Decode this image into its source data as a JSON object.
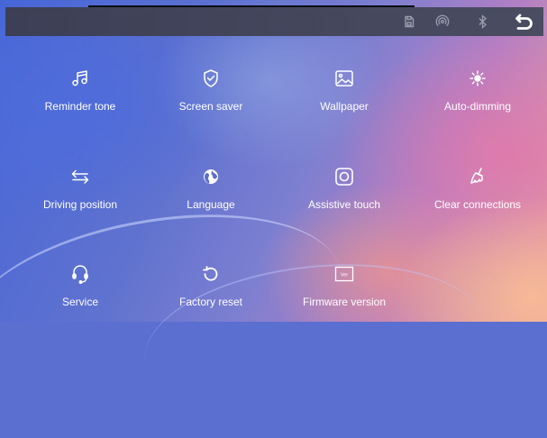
{
  "header": {
    "status_icons": [
      "sd-card-icon",
      "hotspot-icon",
      "bluetooth-icon"
    ],
    "back_icon": "back-arrow-icon"
  },
  "tiles": [
    {
      "id": "reminder-tone",
      "label": "Reminder tone",
      "icon": "music-note-icon"
    },
    {
      "id": "screen-saver",
      "label": "Screen saver",
      "icon": "shield-check-icon"
    },
    {
      "id": "wallpaper",
      "label": "Wallpaper",
      "icon": "image-icon"
    },
    {
      "id": "auto-dimming",
      "label": "Auto-dimming",
      "icon": "brightness-icon"
    },
    {
      "id": "driving-position",
      "label": "Driving position",
      "icon": "swap-arrows-icon"
    },
    {
      "id": "language",
      "label": "Language",
      "icon": "globe-icon"
    },
    {
      "id": "assistive-touch",
      "label": "Assistive touch",
      "icon": "assistive-touch-icon"
    },
    {
      "id": "clear-connections",
      "label": "Clear connections",
      "icon": "broom-icon"
    },
    {
      "id": "service",
      "label": "Service",
      "icon": "headset-icon"
    },
    {
      "id": "factory-reset",
      "label": "Factory reset",
      "icon": "reset-icon"
    },
    {
      "id": "firmware-version",
      "label": "Firmware version",
      "icon": "firmware-ver-icon",
      "badge": "Ver"
    }
  ],
  "colors": {
    "header": "#40435a",
    "text": "#ffffff",
    "icon": "#ffffff"
  }
}
